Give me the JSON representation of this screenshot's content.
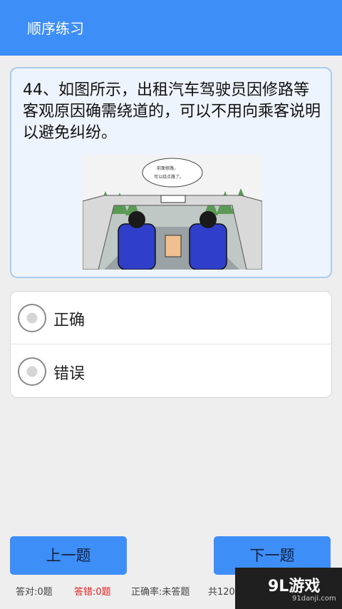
{
  "header": {
    "title": "顺序练习"
  },
  "question": {
    "text": "44、如图所示，出租汽车驾驶员因修路等客观原因确需绕道的，可以不用向乘客说明以避免纠纷。",
    "image_speech": [
      "前面修路，",
      "可以绕点路了。"
    ]
  },
  "options": [
    {
      "label": "正确"
    },
    {
      "label": "错误"
    }
  ],
  "buttons": {
    "prev": "上一题",
    "next": "下一题"
  },
  "stats": {
    "correct": "答对:0题",
    "wrong": "答错:0题",
    "rate": "正确率:未答题",
    "total": "共120"
  },
  "watermark": {
    "logo": "9L游戏",
    "url": "91danji.com"
  },
  "colors": {
    "header": "#3e8ef7",
    "wrong_text": "#e02020"
  }
}
